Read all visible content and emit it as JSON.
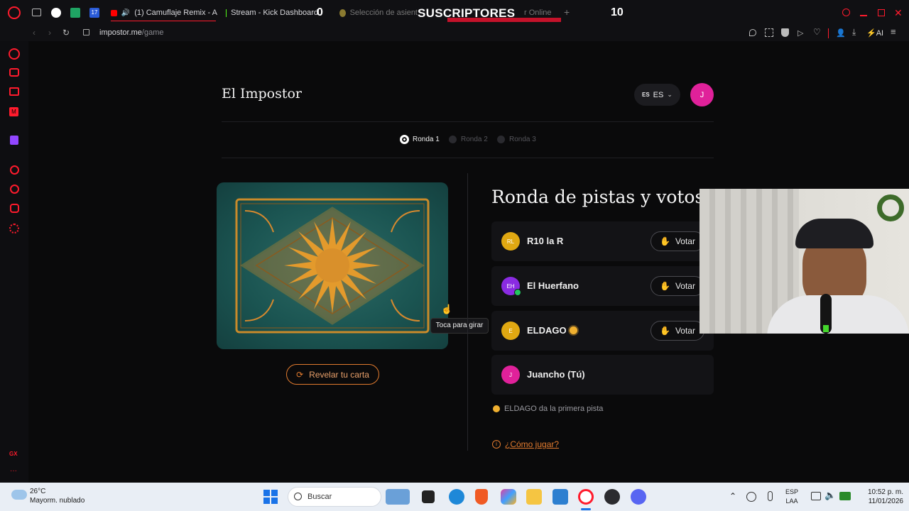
{
  "browser": {
    "tabs": [
      {
        "label": "(1) Camuflaje Remix - A"
      },
      {
        "label": "Stream - Kick Dashboard"
      },
      {
        "label": "Selección de asient"
      },
      {
        "label": "r Online"
      }
    ],
    "url_host": "impostor.me",
    "url_path": "/game",
    "overlay_counter_left": "0",
    "overlay_title": "SUSCRIPTORES",
    "overlay_counter_right": "10",
    "ai_label": "AI"
  },
  "app": {
    "title": "El Impostor",
    "lang_flag": "ES",
    "lang_label": "ES",
    "user_initial": "J"
  },
  "rounds": [
    {
      "label": "Ronda 1",
      "active": true
    },
    {
      "label": "Ronda 2",
      "active": false
    },
    {
      "label": "Ronda 3",
      "active": false
    }
  ],
  "card": {
    "tooltip": "Toca para girar",
    "reveal_label": "Revelar tu carta"
  },
  "panel": {
    "title": "Ronda de pistas y votos",
    "vote_label": "Votar",
    "players": [
      {
        "initials": "RL",
        "name": "R10 la R",
        "color": "#e0a812"
      },
      {
        "initials": "EH",
        "name": "El Huerfano",
        "color": "#8a2be2"
      },
      {
        "initials": "E",
        "name": "ELDAGO",
        "color": "#e0a812"
      },
      {
        "initials": "J",
        "name": "Juancho (Tú)",
        "color": "#e0219a"
      }
    ],
    "hint_text": "ELDAGO da la primera pista",
    "how_to_play": "¿Cómo jugar?"
  },
  "taskbar": {
    "weather_temp": "26°C",
    "weather_desc": "Mayorm. nublado",
    "search_placeholder": "Buscar",
    "lang_top": "ESP",
    "lang_bottom": "LAA",
    "time": "10:52 p. m.",
    "date": "11/01/2026"
  },
  "rail": {
    "gx_label": "GX"
  },
  "colors": {
    "accent": "#e0219a",
    "orange": "#e07a2e",
    "opera_red": "#ff1b2d"
  }
}
